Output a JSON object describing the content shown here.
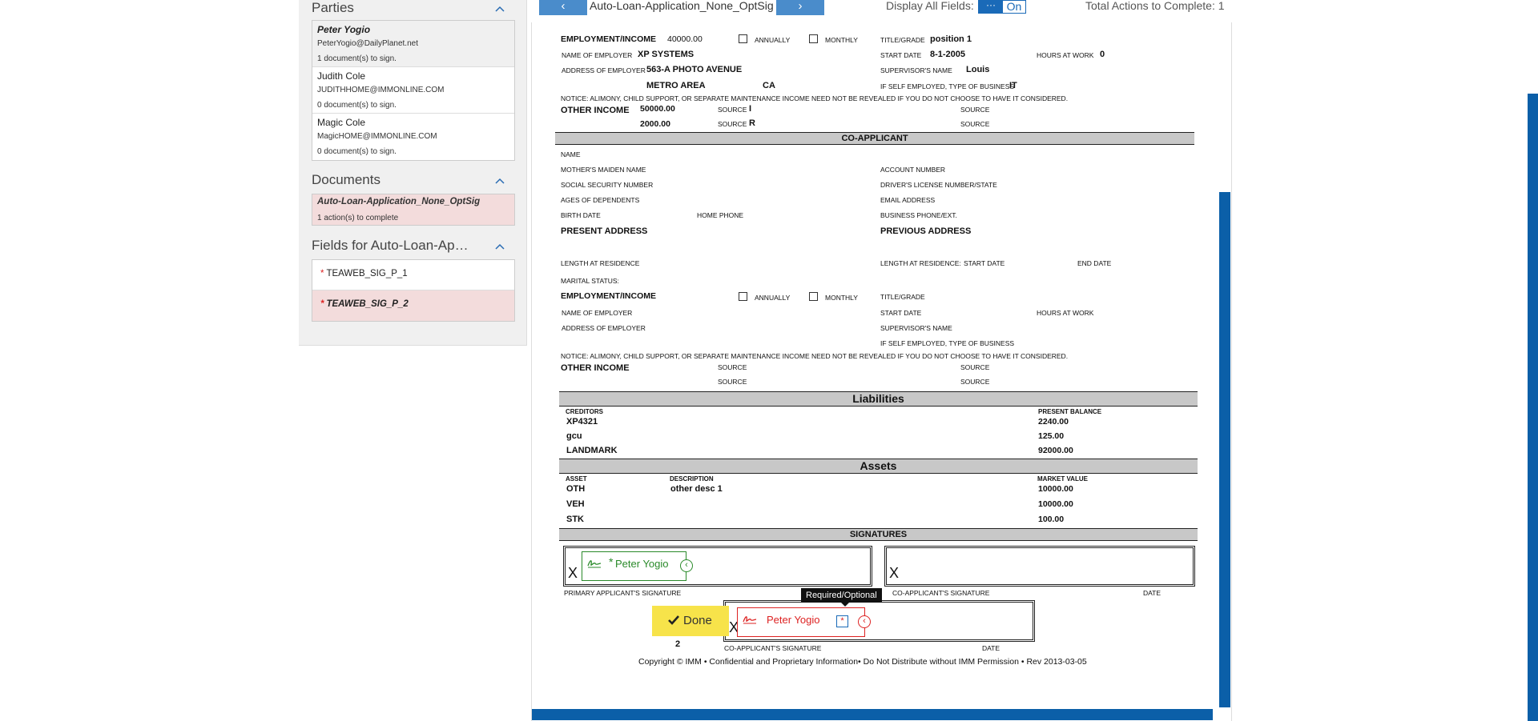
{
  "parties": {
    "title": "Parties",
    "items": [
      {
        "name": "Peter Yogio",
        "email": "PeterYogio@DailyPlanet.net",
        "count": "1 document(s) to sign."
      },
      {
        "name": "Judith Cole",
        "email": "JUDITHHOME@IMMONLINE.COM",
        "count": "0 document(s) to sign."
      },
      {
        "name": "Magic Cole",
        "email": "MagicHOME@IMMONLINE.COM",
        "count": "0 document(s) to sign."
      }
    ]
  },
  "documents": {
    "title": "Documents",
    "items": [
      {
        "name": "Auto-Loan-Application_None_OptSig",
        "count": "1 action(s) to complete"
      }
    ]
  },
  "fields": {
    "title": "Fields for Auto-Loan-Appl...",
    "items": [
      {
        "required": "*",
        "label": "TEAWEB_SIG_P_1"
      },
      {
        "required": "*",
        "label": "TEAWEB_SIG_P_2"
      }
    ]
  },
  "toolbar": {
    "prev_label": "‹",
    "next_label": "›",
    "doc_title": "Auto-Loan-Application_None_OptSig",
    "display_label": "Display All Fields:",
    "toggle_dots": "···",
    "toggle_state": "On",
    "total_actions": "Total Actions to Complete: 1"
  },
  "form": {
    "applicant": {
      "employment_label": "EMPLOYMENT/INCOME",
      "employment_value": "40000.00",
      "annually": "ANNUALLY",
      "monthly": "MONTHLY",
      "title_grade_label": "TITLE/GRADE",
      "title_grade_value": "position 1",
      "employer_label": "NAME OF EMPLOYER",
      "employer_value": "XP SYSTEMS",
      "start_date_label": "START DATE",
      "start_date_value": "8-1-2005",
      "hours_label": "HOURS AT WORK",
      "hours_value": "0",
      "address_label": "ADDRESS OF EMPLOYER",
      "address_value": "563-A PHOTO AVENUE",
      "supervisor_label": "SUPERVISOR'S NAME",
      "supervisor_value": "Louis",
      "city_value": "METRO AREA",
      "state_value": "CA",
      "self_employed_label": "IF SELF EMPLOYED, TYPE OF BUSINESS",
      "self_employed_value": "IT",
      "notice": "NOTICE: ALIMONY, CHILD SUPPORT, OR SEPARATE MAINTENANCE INCOME NEED NOT BE REVEALED IF YOU DO NOT CHOOSE TO HAVE IT CONSIDERED.",
      "other_income_label": "OTHER INCOME",
      "other_income_1": "50000.00",
      "other_income_2": "2000.00",
      "source_label": "SOURCE",
      "source_1": "I",
      "source_2": "R"
    },
    "coapplicant": {
      "header": "CO-APPLICANT",
      "name": "NAME",
      "maiden": "MOTHER'S MAIDEN NAME",
      "account": "ACCOUNT NUMBER",
      "ssn": "SOCIAL SECURITY NUMBER",
      "license": "DRIVER'S LICENSE NUMBER/STATE",
      "ages": "AGES OF DEPENDENTS",
      "email": "EMAIL ADDRESS",
      "birth": "BIRTH DATE",
      "home_phone": "HOME PHONE",
      "business_phone": "BUSINESS PHONE/EXT.",
      "present_address": "PRESENT ADDRESS",
      "previous_address": "PREVIOUS ADDRESS",
      "length": "LENGTH AT RESIDENCE",
      "length_prev": "LENGTH AT RESIDENCE:",
      "start_date": "START DATE",
      "end_date": "END DATE",
      "marital": "MARITAL STATUS:",
      "employment": "EMPLOYMENT/INCOME",
      "annually": "ANNUALLY",
      "monthly": "MONTHLY",
      "title_grade": "TITLE/GRADE",
      "employer": "NAME OF EMPLOYER",
      "emp_start": "START DATE",
      "hours": "HOURS AT WORK",
      "address": "ADDRESS OF EMPLOYER",
      "supervisor": "SUPERVISOR'S NAME",
      "self_employed": "IF SELF EMPLOYED, TYPE OF BUSINESS",
      "notice": "NOTICE: ALIMONY, CHILD SUPPORT, OR SEPARATE MAINTENANCE INCOME NEED NOT BE REVEALED IF YOU DO NOT CHOOSE TO HAVE IT CONSIDERED.",
      "other_income": "OTHER INCOME",
      "source": "SOURCE"
    },
    "liabilities": {
      "header": "Liabilities",
      "col1": "CREDITORS",
      "col2": "PRESENT BALANCE",
      "rows": [
        {
          "creditor": "XP4321",
          "balance": "2240.00"
        },
        {
          "creditor": "gcu",
          "balance": "125.00"
        },
        {
          "creditor": "LANDMARK",
          "balance": "92000.00"
        }
      ]
    },
    "assets": {
      "header": "Assets",
      "col1": "ASSET",
      "col2": "DESCRIPTION",
      "col3": "MARKET VALUE",
      "rows": [
        {
          "asset": "OTH",
          "desc": "other desc 1",
          "value": "10000.00"
        },
        {
          "asset": "VEH",
          "desc": "",
          "value": "10000.00"
        },
        {
          "asset": "STK",
          "desc": "",
          "value": "100.00"
        }
      ]
    },
    "signatures": {
      "header": "SIGNATURES",
      "x": "X",
      "primary_label": "PRIMARY APPLICANT'S SIGNATURE",
      "co_label_1": "CO-APPLICANT'S SIGNATURE",
      "date_1": "DATE",
      "co_label_2": "CO-APPLICANT'S SIGNATURE",
      "date_2": "DATE"
    },
    "copyright": "Copyright © IMM • Confidential and Proprietary Information• Do Not Distribute without IMM Permission • Rev 2013-03-05"
  },
  "sig_tags": {
    "tag1_star": "*",
    "tag1_name": "Peter Yogio",
    "tag2_name": "Peter Yogio",
    "req_star": "*",
    "tooltip": "Required/Optional",
    "arrow": "‹"
  },
  "done": {
    "label": "Done",
    "count": "2"
  },
  "colors": {
    "accent": "#0b5fa8",
    "nav": "#4a8ccb",
    "highlight": "#f3dcdc",
    "done": "#f7e34a",
    "required": "#dd2222",
    "signed": "#2a8a2a"
  }
}
